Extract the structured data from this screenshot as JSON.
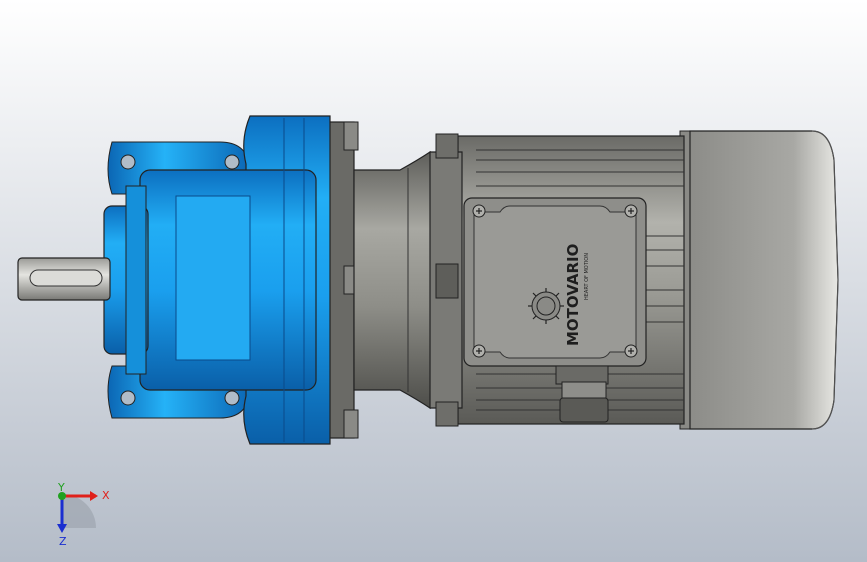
{
  "viewport": {
    "background_top": "#ffffff",
    "background_bottom": "#b4bcc8"
  },
  "model": {
    "gearbox_color": "#1aa0ec",
    "gearbox_dark": "#0e6eb8",
    "housing_color": "#8c8c88",
    "motor_cover_color": "#a6a6a2",
    "nameplate": {
      "brand_logo": "MOTOVARIO",
      "tagline": "HEART OF MOTION"
    }
  },
  "triad": {
    "x_label": "X",
    "y_label": "Y",
    "z_label": "Z",
    "x_color": "#e0201a",
    "y_color": "#20a020",
    "z_color": "#1a2ed0"
  }
}
